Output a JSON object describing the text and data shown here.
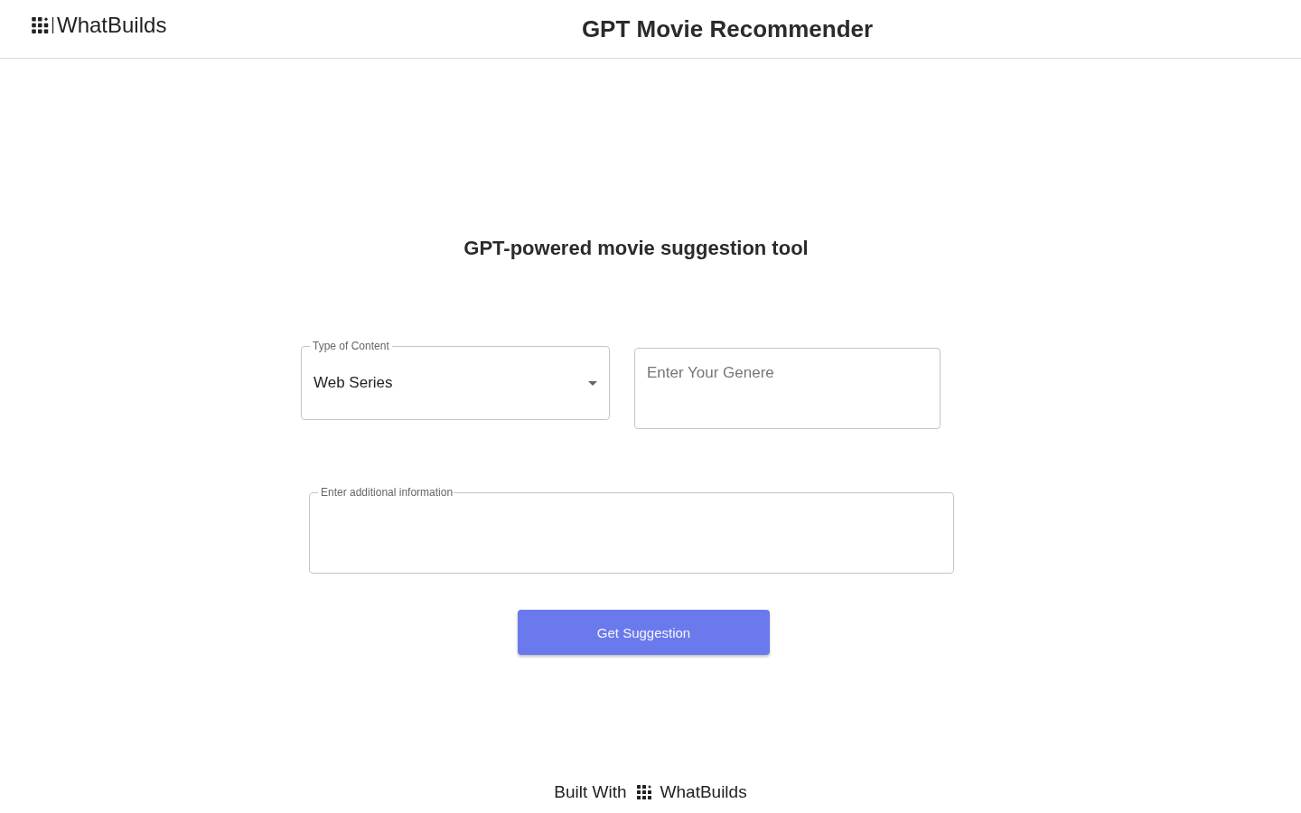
{
  "header": {
    "logo": "WhatBuilds",
    "title": "GPT Movie Recommender"
  },
  "intro": {
    "heading": "GPT-powered movie suggestion tool"
  },
  "form": {
    "content_type": {
      "label": "Type of Content",
      "value": "Web Series"
    },
    "genre": {
      "placeholder": "Enter Your Genere"
    },
    "additional_info": {
      "label": "Enter additional information"
    },
    "submit": {
      "label": "Get Suggestion"
    }
  },
  "footer": {
    "prefix": "Built With",
    "brand": "WhatBuilds"
  }
}
